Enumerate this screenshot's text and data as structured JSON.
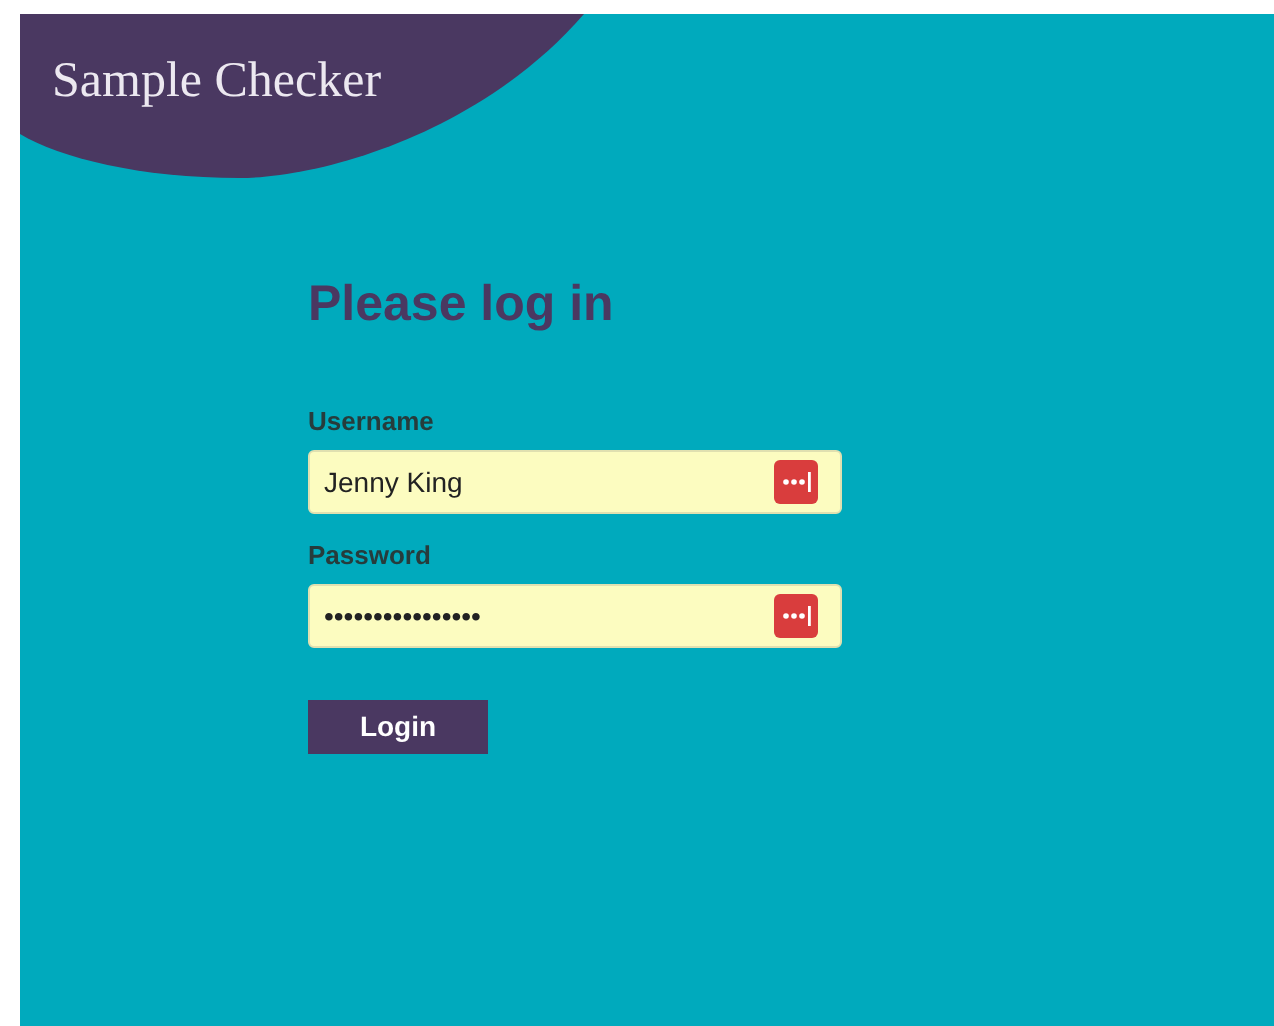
{
  "app": {
    "title": "Sample Checker"
  },
  "form": {
    "heading": "Please log in",
    "fields": [
      {
        "label": "Username",
        "value": "Jenny King"
      },
      {
        "label": "Password",
        "value": "••••••••••••••••"
      }
    ],
    "submit": "Login"
  }
}
